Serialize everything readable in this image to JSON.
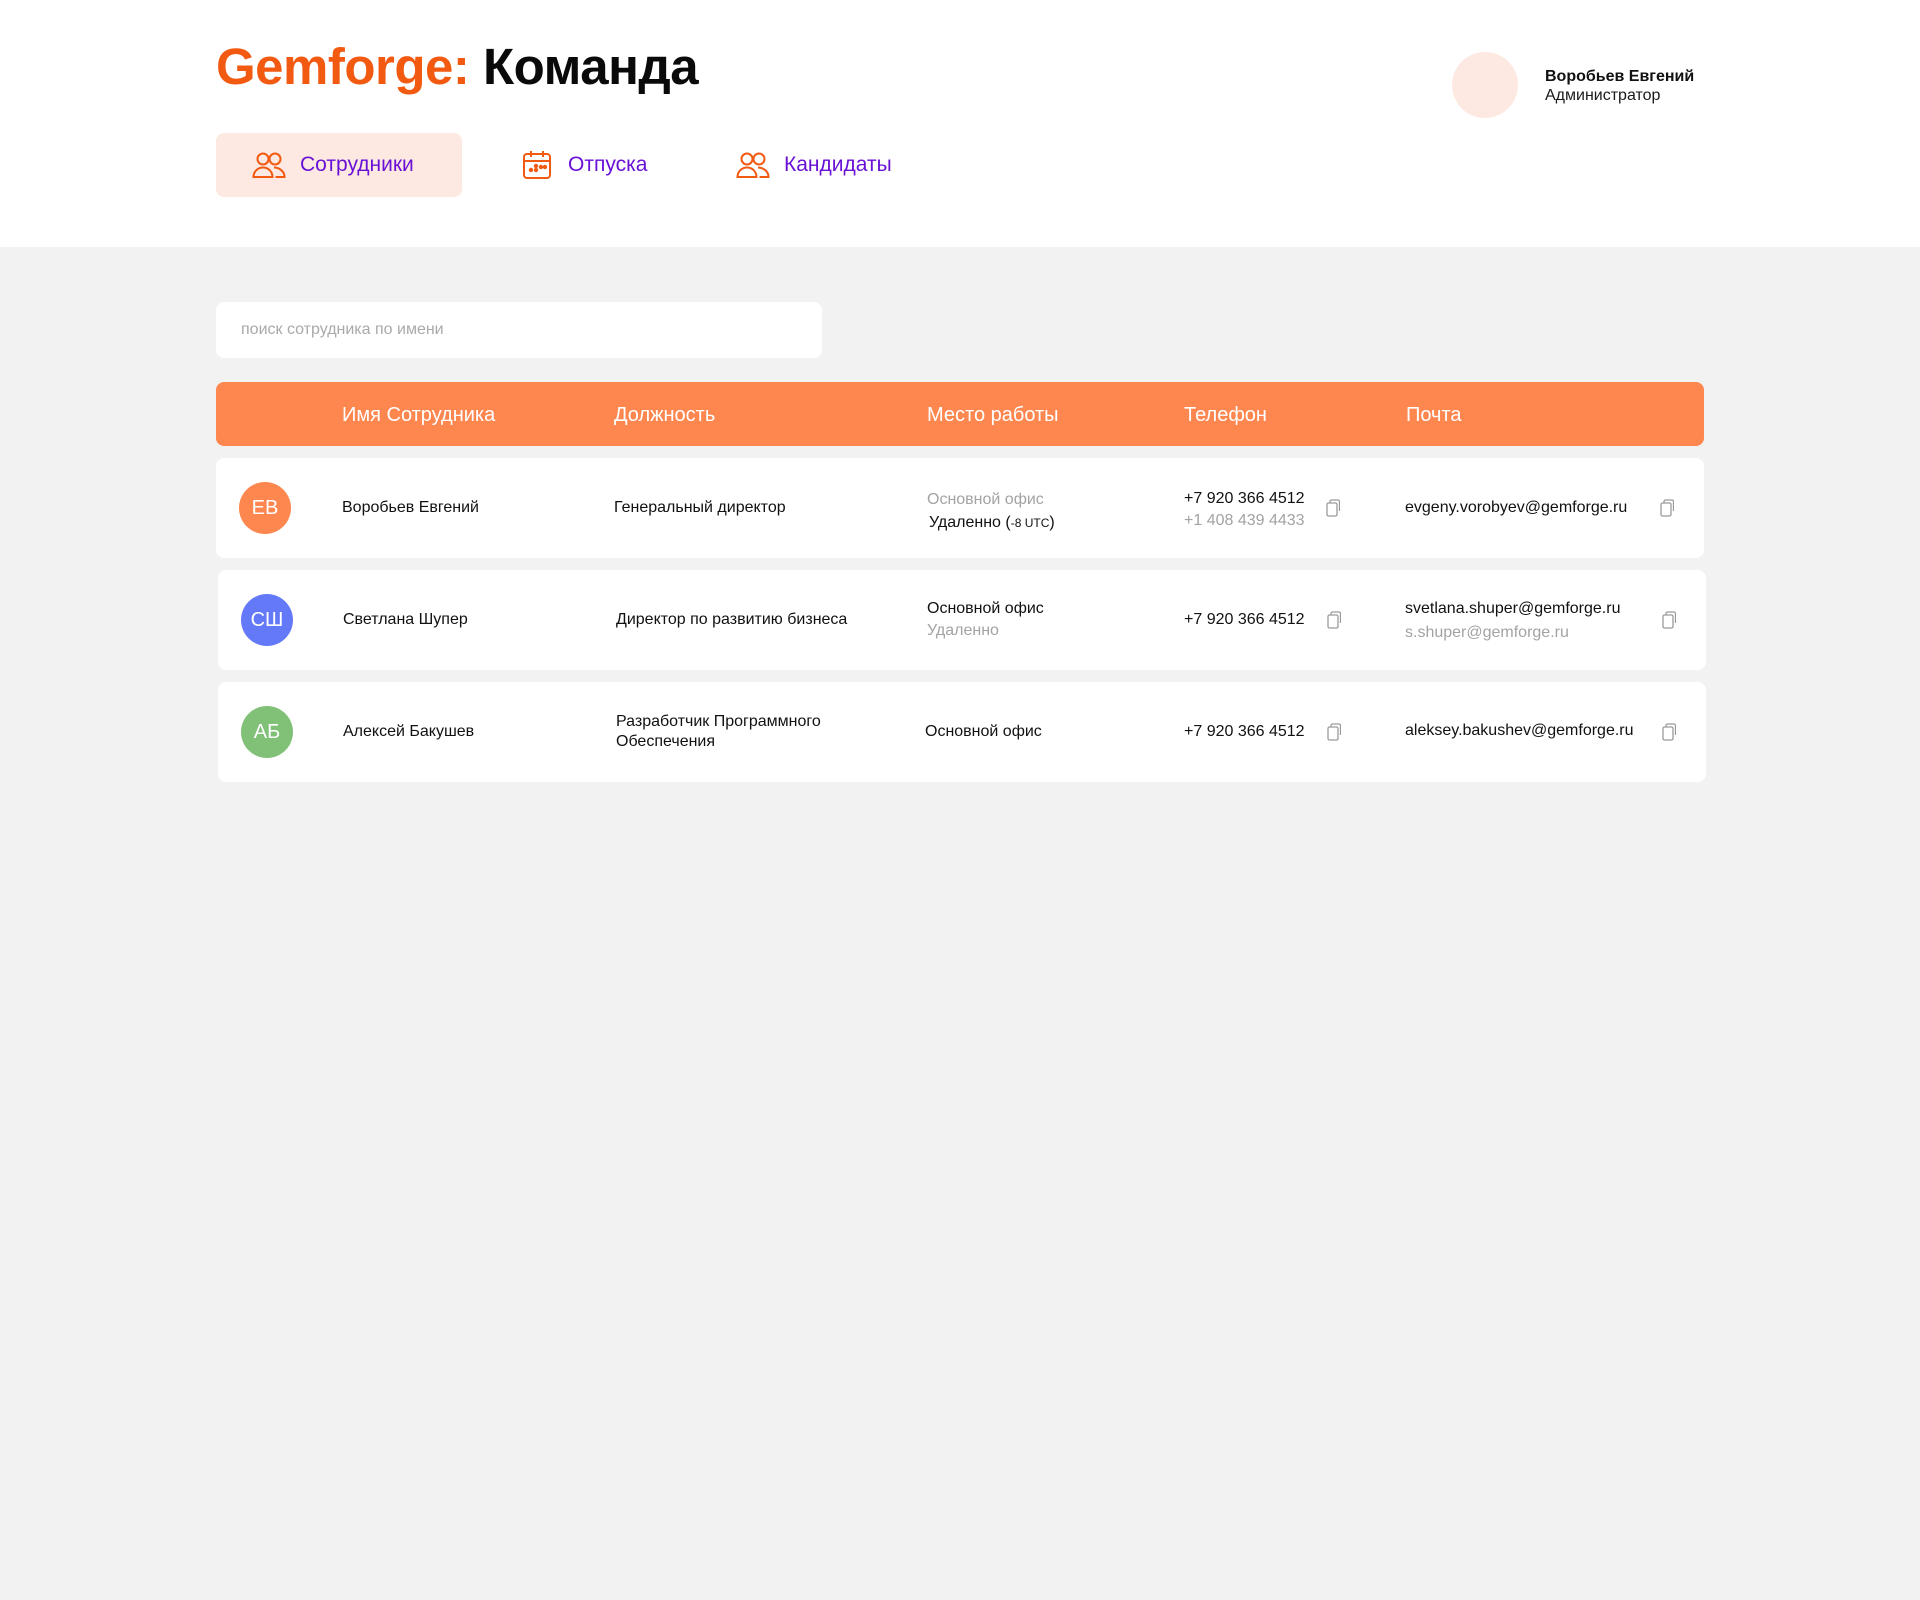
{
  "header": {
    "brand": "Gemforge:",
    "section": "Команда",
    "user": {
      "name": "Воробьев Евгений",
      "role": "Администратор"
    }
  },
  "tabs": [
    {
      "label": "Сотрудники",
      "icon": "users-icon",
      "active": true
    },
    {
      "label": "Отпуска",
      "icon": "calendar-icon",
      "active": false
    },
    {
      "label": "Кандидаты",
      "icon": "users-icon",
      "active": false
    }
  ],
  "search": {
    "placeholder": "поиск сотрудника по имени",
    "value": ""
  },
  "table": {
    "columns": [
      "Имя Сотрудника",
      "Должность",
      "Место работы",
      "Телефон",
      "Почта"
    ],
    "rows": [
      {
        "initials": "ЕВ",
        "avatar_color": "#fe8750",
        "name": "Воробьев Евгений",
        "position": "Генеральный директор",
        "workplace_primary": "Основной офис",
        "workplace_secondary": "Удаленно (",
        "workplace_tz": "-8 UTC",
        "workplace_close": ")",
        "phone_primary": "+7 920 366 4512",
        "phone_secondary": "+1 408 439 4433",
        "email_primary": "evgeny.vorobyev@gemforge.ru"
      },
      {
        "initials": "СШ",
        "avatar_color": "#6479f7",
        "name": "Светлана Шупер",
        "position": "Директор по развитию бизнеса",
        "workplace_primary": "Основной офис",
        "workplace_secondary": "Удаленно",
        "phone_primary": "+7 920 366 4512",
        "email_primary": "svetlana.shuper@gemforge.ru",
        "email_secondary": "s.shuper@gemforge.ru"
      },
      {
        "initials": "АБ",
        "avatar_color": "#80c177",
        "name": "Алексей Бакушев",
        "position_line1": "Разработчик Программного",
        "position_line2": "Обеспечения",
        "workplace_primary": "Основной офис",
        "phone_primary": "+7 920 366 4512",
        "email_primary": "aleksey.bakushev@gemforge.ru"
      }
    ]
  },
  "colors": {
    "brand": "#f25a12",
    "accent": "#fe8750",
    "tab_text": "#6a11d6",
    "active_tab_bg": "#fde9e1",
    "page_bg": "#f2f2f2"
  }
}
